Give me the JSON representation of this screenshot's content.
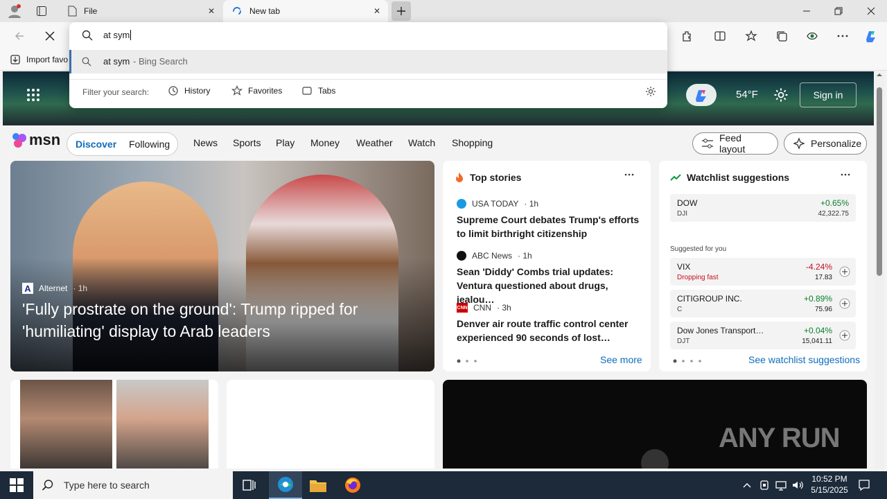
{
  "tabs": [
    {
      "label": "File",
      "icon": "page-icon"
    },
    {
      "label": "New tab",
      "icon": "loading-icon"
    }
  ],
  "omnibox": {
    "query": "at sym",
    "suggestion": {
      "text": "at sym",
      "suffix": " - Bing Search"
    },
    "filter_label": "Filter your search:",
    "filters": [
      "History",
      "Favorites",
      "Tabs"
    ]
  },
  "favorites_bar": {
    "import_label": "Import favo"
  },
  "msn": {
    "logo_text": "msn",
    "temperature": "54°F",
    "sign_in": "Sign in",
    "segments": [
      "Discover",
      "Following"
    ],
    "nav": [
      "News",
      "Sports",
      "Play",
      "Money",
      "Weather",
      "Watch",
      "Shopping"
    ],
    "feed_layout": "Feed layout",
    "personalize": "Personalize"
  },
  "hero": {
    "source": "Alternet",
    "age": "· 1h",
    "headline": "'Fully prostrate on the ground': Trump ripped for 'humiliating' display to Arab leaders"
  },
  "top_stories": {
    "title": "Top stories",
    "items": [
      {
        "source": "USA TODAY",
        "age": "· 1h",
        "headline": "Supreme Court debates Trump's efforts to limit birthright citizenship",
        "color": "#1a9be0"
      },
      {
        "source": "ABC News",
        "age": "· 1h",
        "headline": "Sean 'Diddy' Combs trial updates: Ventura questioned about drugs, jealou…",
        "color": "#111111"
      },
      {
        "source": "CNN",
        "age": "· 3h",
        "headline": "Denver air route traffic control center experienced 90 seconds of lost…",
        "color": "#cc0000"
      }
    ],
    "see_more": "See more"
  },
  "watchlist": {
    "title": "Watchlist suggestions",
    "main": {
      "name": "DOW",
      "symbol": "DJI",
      "change": "+0.65%",
      "price": "42,322.75"
    },
    "suggested_label": "Suggested for you",
    "items": [
      {
        "name": "VIX",
        "sub": "Dropping fast",
        "change": "-4.24%",
        "price": "17.83",
        "negative": true
      },
      {
        "name": "CITIGROUP INC.",
        "sub": "C",
        "change": "+0.89%",
        "price": "75.96",
        "negative": false
      },
      {
        "name": "Dow Jones Transport…",
        "sub": "DJT",
        "change": "+0.04%",
        "price": "15,041.11",
        "negative": false
      }
    ],
    "see_link": "See watchlist suggestions"
  },
  "watermark": "ANY RUN",
  "taskbar": {
    "search_placeholder": "Type here to search",
    "time": "10:52 PM",
    "date": "5/15/2025"
  },
  "colors": {
    "accent": "#0f6cbd",
    "positive": "#0a7f2e",
    "negative": "#c50f1f",
    "taskbar": "#1c2a3a"
  }
}
